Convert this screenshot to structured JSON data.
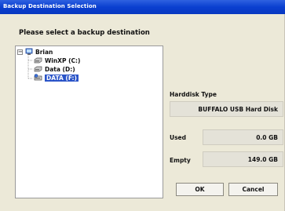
{
  "window": {
    "title": "Backup Destination Selection"
  },
  "prompt": "Please select a backup destination",
  "tree": {
    "root": {
      "label": "Brian",
      "expander": "−"
    },
    "items": [
      {
        "label": "WinXP (C:)",
        "icon": "hard-drive-icon",
        "selected": false
      },
      {
        "label": "Data (D:)",
        "icon": "hard-drive-icon",
        "selected": false
      },
      {
        "label": "DATA (F:)",
        "icon": "usb-drive-icon",
        "selected": true
      }
    ]
  },
  "details": {
    "harddisk_type_label": "Harddisk Type",
    "harddisk_type_value": "BUFFALO USB Hard Disk",
    "used_label": "Used",
    "used_value": "0.0 GB",
    "empty_label": "Empty",
    "empty_value": "149.0 GB"
  },
  "buttons": {
    "ok": "OK",
    "cancel": "Cancel"
  },
  "colors": {
    "titlebar": "#0a3fd0",
    "selection": "#2a54c8",
    "dialog_bg": "#ece9d8"
  }
}
